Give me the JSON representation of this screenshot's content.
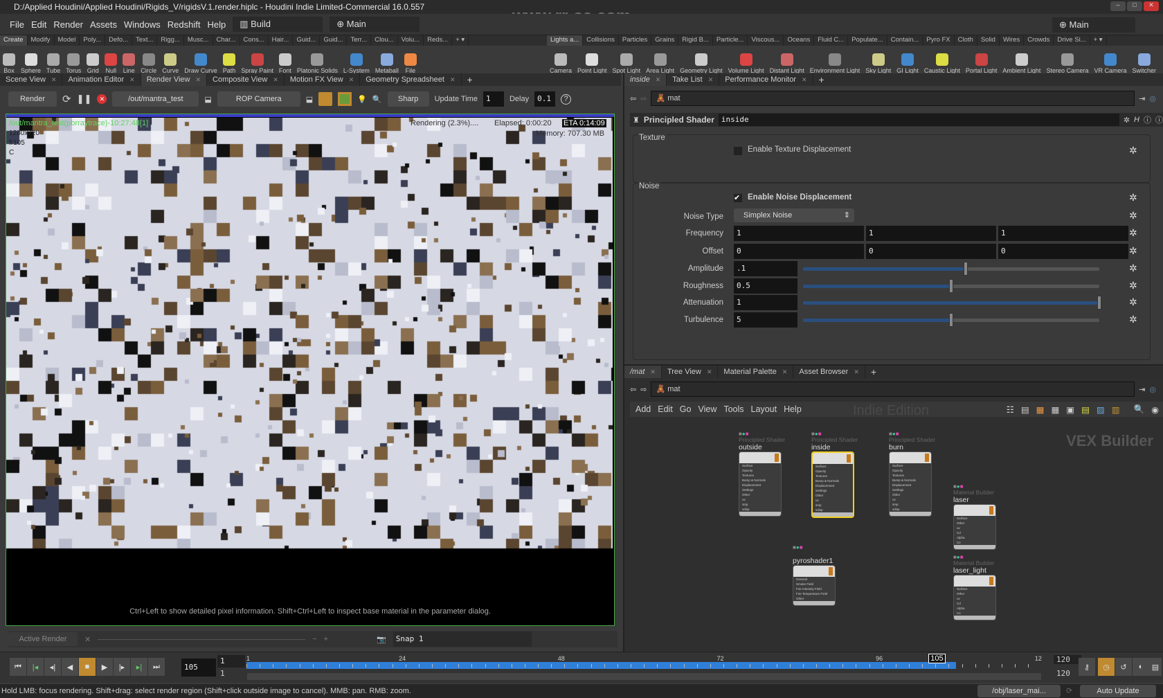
{
  "window": {
    "title": "D:/Applied Houdini/Applied Houdini/Rigids_V/rigidsV.1.render.hiplc - Houdini Indie Limited-Commercial 16.0.557"
  },
  "watermark": "www.rr-sc.com",
  "menu": {
    "items": [
      "File",
      "Edit",
      "Render",
      "Assets",
      "Windows",
      "Redshift",
      "Help"
    ],
    "desktop": "Build",
    "main": "Main",
    "right_desktop": "Main"
  },
  "shelf_left": {
    "tabs": [
      "Create",
      "Modify",
      "Model",
      "Poly...",
      "Defo...",
      "Text...",
      "Rigg...",
      "Musc...",
      "Char...",
      "Cons...",
      "Hair...",
      "Guid...",
      "Guid...",
      "Terr...",
      "Clou...",
      "Volu...",
      "Reds..."
    ],
    "tools": [
      "Box",
      "Sphere",
      "Tube",
      "Torus",
      "Grid",
      "Null",
      "Line",
      "Circle",
      "Curve",
      "Draw Curve",
      "Path",
      "Spray Paint",
      "Font",
      "Platonic Solids",
      "L-System",
      "Metaball",
      "File"
    ]
  },
  "shelf_right": {
    "tabs": [
      "Lights a...",
      "Collisions",
      "Particles",
      "Grains",
      "Rigid B...",
      "Particle...",
      "Viscous...",
      "Oceans",
      "Fluid C...",
      "Populate...",
      "Contain...",
      "Pyro FX",
      "Cloth",
      "Solid",
      "Wires",
      "Crowds",
      "Drive Si..."
    ],
    "tools": [
      "Camera",
      "Point Light",
      "Spot Light",
      "Area Light",
      "Geometry Light",
      "Volume Light",
      "Distant Light",
      "Environment Light",
      "Sky Light",
      "GI Light",
      "Caustic Light",
      "Portal Light",
      "Ambient Light",
      "Stereo Camera",
      "VR Camera",
      "Switcher"
    ]
  },
  "left_tabs": [
    "Scene View",
    "Animation Editor",
    "Render View",
    "Composite View",
    "Motion FX View",
    "Geometry Spreadsheet"
  ],
  "render_toolbar": {
    "render": "Render",
    "rop": "/out/mantra_test",
    "camera": "ROP Camera",
    "filter": "Sharp",
    "update_time_label": "Update Time",
    "update_time": "1",
    "delay_label": "Delay",
    "delay": "0.1"
  },
  "viewer": {
    "render_name": "/out/mantra_test(pbrraytrace)-10:27:48[1]",
    "resolution": "1280x720",
    "frame": "fr105",
    "channel": "C",
    "rendering": "Rendering (2.3%)....",
    "elapsed": "Elapsed: 0:00:20",
    "eta": "ETA 0:14:09",
    "memory": "Memory:  707.30 MB",
    "hint": "Ctrl+Left to show detailed pixel information. Shift+Ctrl+Left to inspect base material in the parameter dialog."
  },
  "snap_bar": {
    "active_render": "Active Render",
    "snap": "Snap 1"
  },
  "timeline": {
    "frame": "105",
    "start1": "1",
    "start2": "1",
    "end1": "120",
    "end2": "120",
    "ticks": [
      "1",
      "24",
      "48",
      "72",
      "96",
      "12"
    ],
    "current": "105",
    "range": [
      1,
      120
    ]
  },
  "status": {
    "message": "Hold LMB: focus rendering. Shift+drag: select render region (Shift+click outside image to cancel). MMB: pan. RMB: zoom.",
    "obj_path": "/obj/laser_mai...",
    "update_mode": "Auto Update"
  },
  "param_pane": {
    "tabs": [
      "inside",
      "Take List",
      "Performance Monitor"
    ],
    "path": "mat",
    "node_type": "Principled Shader",
    "node_name": "inside",
    "texture": {
      "title": "Texture",
      "enable_label": "Enable Texture Displacement",
      "enabled": false
    },
    "noise": {
      "title": "Noise",
      "enable_label": "Enable Noise Displacement",
      "enabled": true,
      "noise_type_label": "Noise Type",
      "noise_type": "Simplex Noise",
      "frequency_label": "Frequency",
      "frequency": [
        "1",
        "1",
        "1"
      ],
      "offset_label": "Offset",
      "offset": [
        "0",
        "0",
        "0"
      ],
      "sliders": [
        {
          "label": "Amplitude",
          "value": ".1",
          "fraction": 0.55
        },
        {
          "label": "Roughness",
          "value": "0.5",
          "fraction": 0.5
        },
        {
          "label": "Attenuation",
          "value": "1",
          "fraction": 1.0
        },
        {
          "label": "Turbulence",
          "value": "5",
          "fraction": 0.5
        }
      ]
    }
  },
  "network_pane": {
    "tabs": [
      "/mat",
      "Tree View",
      "Material Palette",
      "Asset Browser"
    ],
    "path": "mat",
    "menu": [
      "Add",
      "Edit",
      "Go",
      "View",
      "Tools",
      "Layout",
      "Help"
    ],
    "context": "VEX Builder",
    "edition": "Indie Edition",
    "nodes": [
      {
        "type": "Principled Shader",
        "name": "outside",
        "inputs": [
          "Surface",
          "Opacity",
          "Textures",
          "Bump & Normals",
          "Displacement",
          "Settings",
          "Other",
          "uv",
          "sInp",
          "sdisp"
        ],
        "selected": false
      },
      {
        "type": "Principled Shader",
        "name": "inside",
        "inputs": [
          "Surface",
          "Opacity",
          "Textures",
          "Bump & Normals",
          "Displacement",
          "Settings",
          "Other",
          "uv",
          "sInp",
          "sdisp"
        ],
        "selected": true
      },
      {
        "type": "Principled Shader",
        "name": "burn",
        "inputs": [
          "Surface",
          "Opacity",
          "Textures",
          "Bump & Normals",
          "Displacement",
          "Settings",
          "Other",
          "uv",
          "sInp",
          "sdisp"
        ],
        "selected": false
      },
      {
        "type": "Material Builder",
        "name": "laser",
        "inputs": [
          "Surface",
          "Other",
          "uv",
          "Cd",
          "Alpha",
          "Ce"
        ],
        "selected": false
      },
      {
        "type": "Material Builder",
        "name": "laser_light",
        "inputs": [
          "Surface",
          "Other",
          "uv",
          "Cd",
          "Alpha",
          "Ce"
        ],
        "selected": false
      },
      {
        "type": "",
        "name": "pyroshader1",
        "inputs": [
          "General",
          "Smoke Field",
          "Fire Intensity Field",
          "Fire Temperature Field",
          "Other"
        ],
        "selected": false
      }
    ]
  },
  "colors": {
    "accent_blue": "#2f7fd8",
    "selected_yellow": "#f0d020",
    "render_green": "#5fd35f",
    "orange_button": "#c08a30"
  }
}
